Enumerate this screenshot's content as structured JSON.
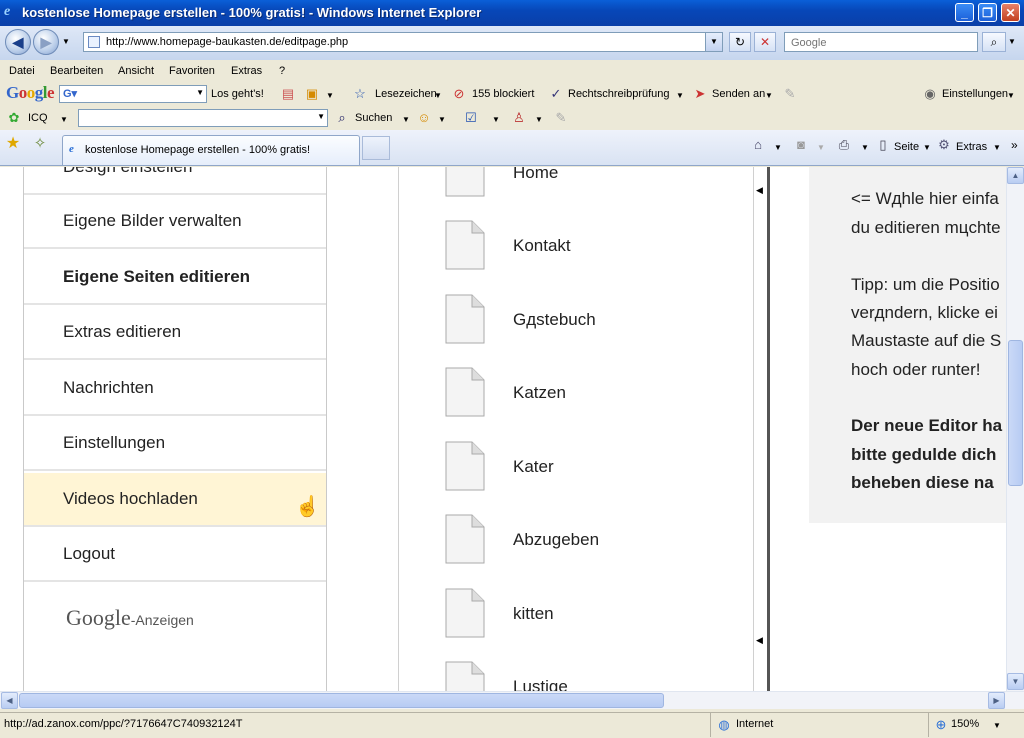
{
  "window": {
    "title": "kostenlose Homepage erstellen - 100% gratis! - Windows Internet Explorer",
    "minimize": "_",
    "maximize": "❐",
    "close": "✕"
  },
  "address_bar": {
    "url": "http://www.homepage-baukasten.de/editpage.php",
    "search_placeholder": "Google"
  },
  "menu": [
    "Datei",
    "Bearbeiten",
    "Ansicht",
    "Favoriten",
    "Extras",
    "?"
  ],
  "google_toolbar": {
    "logo": "Google",
    "search_button": "Los geht's!",
    "bookmarks": "Lesezeichen",
    "blocked": "155 blockiert",
    "spellcheck": "Rechtschreibprüfung",
    "send": "Senden an",
    "settings": "Einstellungen"
  },
  "icq_toolbar": {
    "icq": "ICQ",
    "search": "Suchen"
  },
  "tabs": {
    "active_label": "kostenlose Homepage erstellen - 100% gratis!",
    "home": "",
    "page": "Seite",
    "extras": "Extras"
  },
  "sidebar": {
    "items": [
      {
        "label": "Design einstellen"
      },
      {
        "label": "Eigene Bilder verwalten"
      },
      {
        "label": "Eigene Seiten editieren"
      },
      {
        "label": "Extras editieren"
      },
      {
        "label": "Nachrichten"
      },
      {
        "label": "Einstellungen"
      },
      {
        "label": "Videos hochladen"
      },
      {
        "label": "Logout"
      }
    ],
    "ads_logo": "Google",
    "ads_label": "-Anzeigen"
  },
  "pages": [
    "Home",
    "Kontakt",
    "Gдstebuch",
    "Katzen",
    "Kater",
    "Abzugeben",
    "kitten",
    "Lustige"
  ],
  "info": {
    "lines": [
      "<= Wдhle hier einfa",
      "du editieren mцchte",
      "Tipp: um die Positio",
      "verдndern, klicke ei",
      "Maustaste auf die S",
      "hoch oder runter!",
      "Der neue Editor ha",
      "bitte gedulde dich",
      "beheben diese na"
    ]
  },
  "status": {
    "link": "http://ad.zanox.com/ppc/?7176647C740932124T",
    "zone": "Internet",
    "zoom": "150%"
  }
}
